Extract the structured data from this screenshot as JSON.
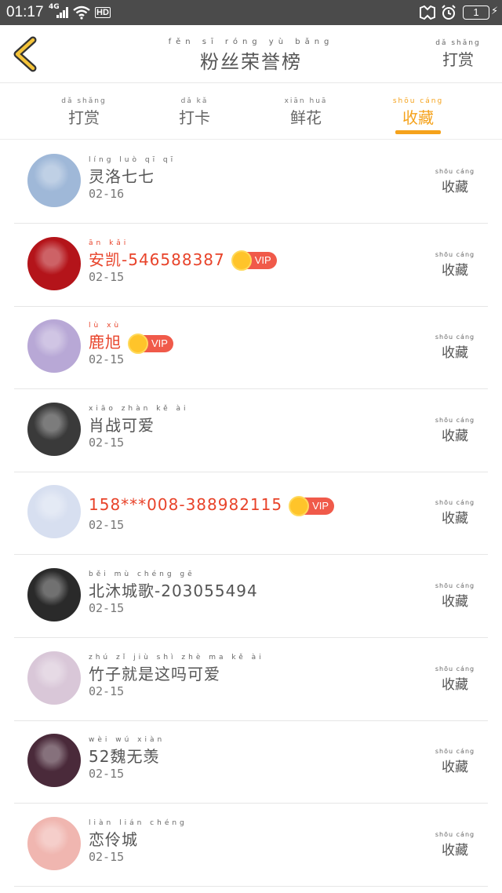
{
  "status_bar": {
    "time": "01:17",
    "network": "4G",
    "hd": "HD",
    "battery": "1"
  },
  "header": {
    "title": "粉丝荣誉榜",
    "title_pinyin": "fěn sī róng yù bǎng",
    "action_label": "打赏",
    "action_pinyin": "dǎ shǎng"
  },
  "tabs": [
    {
      "label": "打赏",
      "pinyin": "dǎ shǎng",
      "active": false
    },
    {
      "label": "打卡",
      "pinyin": "dǎ kǎ",
      "active": false
    },
    {
      "label": "鲜花",
      "pinyin": "xiān huā",
      "active": false
    },
    {
      "label": "收藏",
      "pinyin": "shōu cáng",
      "active": true
    }
  ],
  "list": [
    {
      "name": "灵洛七七",
      "pinyin": "líng luò qī qī",
      "date": "02-16",
      "vip": false,
      "action": "收藏",
      "action_pinyin": "shōu cáng",
      "avatar_color": "#9fb8d8"
    },
    {
      "name": "安凯-546588387",
      "pinyin": "ān kǎi",
      "date": "02-15",
      "vip": true,
      "vip_label": "VIP",
      "action": "收藏",
      "action_pinyin": "shōu cáng",
      "avatar_color": "#b4141a"
    },
    {
      "name": "鹿旭",
      "pinyin": "lù xù",
      "date": "02-15",
      "vip": true,
      "vip_label": "VIP",
      "action": "收藏",
      "action_pinyin": "shōu cáng",
      "avatar_color": "#b8a8d6"
    },
    {
      "name": "肖战可爱",
      "pinyin": "xiāo zhàn kě ài",
      "date": "02-15",
      "vip": false,
      "action": "收藏",
      "action_pinyin": "shōu cáng",
      "avatar_color": "#3a3a3a"
    },
    {
      "name": "158***008-388982115",
      "pinyin": "",
      "date": "02-15",
      "vip": true,
      "vip_label": "VIP",
      "action": "收藏",
      "action_pinyin": "shōu cáng",
      "avatar_color": "#d7dff0"
    },
    {
      "name": "北沐城歌-203055494",
      "pinyin": "běi mù chéng gē",
      "date": "02-15",
      "vip": false,
      "action": "收藏",
      "action_pinyin": "shōu cáng",
      "avatar_color": "#2a2a2a"
    },
    {
      "name": "竹子就是这吗可爱",
      "pinyin": "zhú zǐ jiù shì zhè ma kě ài",
      "date": "02-15",
      "vip": false,
      "action": "收藏",
      "action_pinyin": "shōu cáng",
      "avatar_color": "#d9c7d8"
    },
    {
      "name": "52魏无羡",
      "pinyin": "wèi wú xiàn",
      "date": "02-15",
      "vip": false,
      "action": "收藏",
      "action_pinyin": "shōu cáng",
      "avatar_color": "#4a2a3a"
    },
    {
      "name": "恋伶城",
      "pinyin": "liàn lián chéng",
      "date": "02-15",
      "vip": false,
      "action": "收藏",
      "action_pinyin": "shōu cáng",
      "avatar_color": "#f0b6b0"
    }
  ]
}
